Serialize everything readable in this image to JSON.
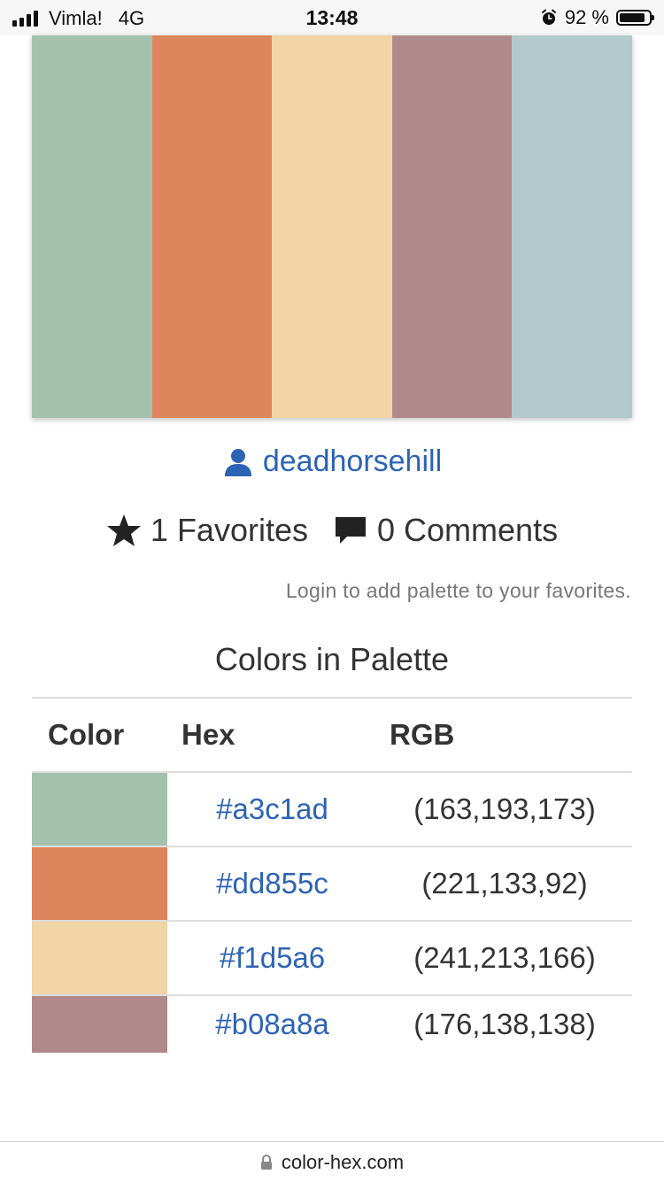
{
  "status_bar": {
    "carrier": "Vimla!",
    "network": "4G",
    "time": "13:48",
    "battery": "92 %",
    "battery_level": 0.92,
    "icons": [
      "signal-icon",
      "alarm-icon",
      "battery-icon"
    ]
  },
  "palette": {
    "swatches": [
      "#a3c1ad",
      "#dd855c",
      "#f1d5a6",
      "#b08a8a",
      "#b2cacb"
    ]
  },
  "author": {
    "icon": "user-icon",
    "name": "deadhorsehill",
    "color": "#2d63b5"
  },
  "stats": {
    "favorites": "1 Favorites",
    "comments": "0 Comments"
  },
  "login_note": "Login to add palette to your favorites.",
  "section_title": "Colors in Palette",
  "table": {
    "headers": [
      "Color",
      "Hex",
      "RGB"
    ],
    "rows": [
      {
        "swatch": "#a3c1ad",
        "hex": "#a3c1ad",
        "rgb": "(163,193,173)"
      },
      {
        "swatch": "#dd855c",
        "hex": "#dd855c",
        "rgb": "(221,133,92)"
      },
      {
        "swatch": "#f1d5a6",
        "hex": "#f1d5a6",
        "rgb": "(241,213,166)"
      },
      {
        "swatch": "#b08a8a",
        "hex": "#b08a8a",
        "rgb": "(176,138,138)"
      }
    ]
  },
  "url_bar": {
    "icon": "lock-icon",
    "domain": "color-hex.com"
  }
}
